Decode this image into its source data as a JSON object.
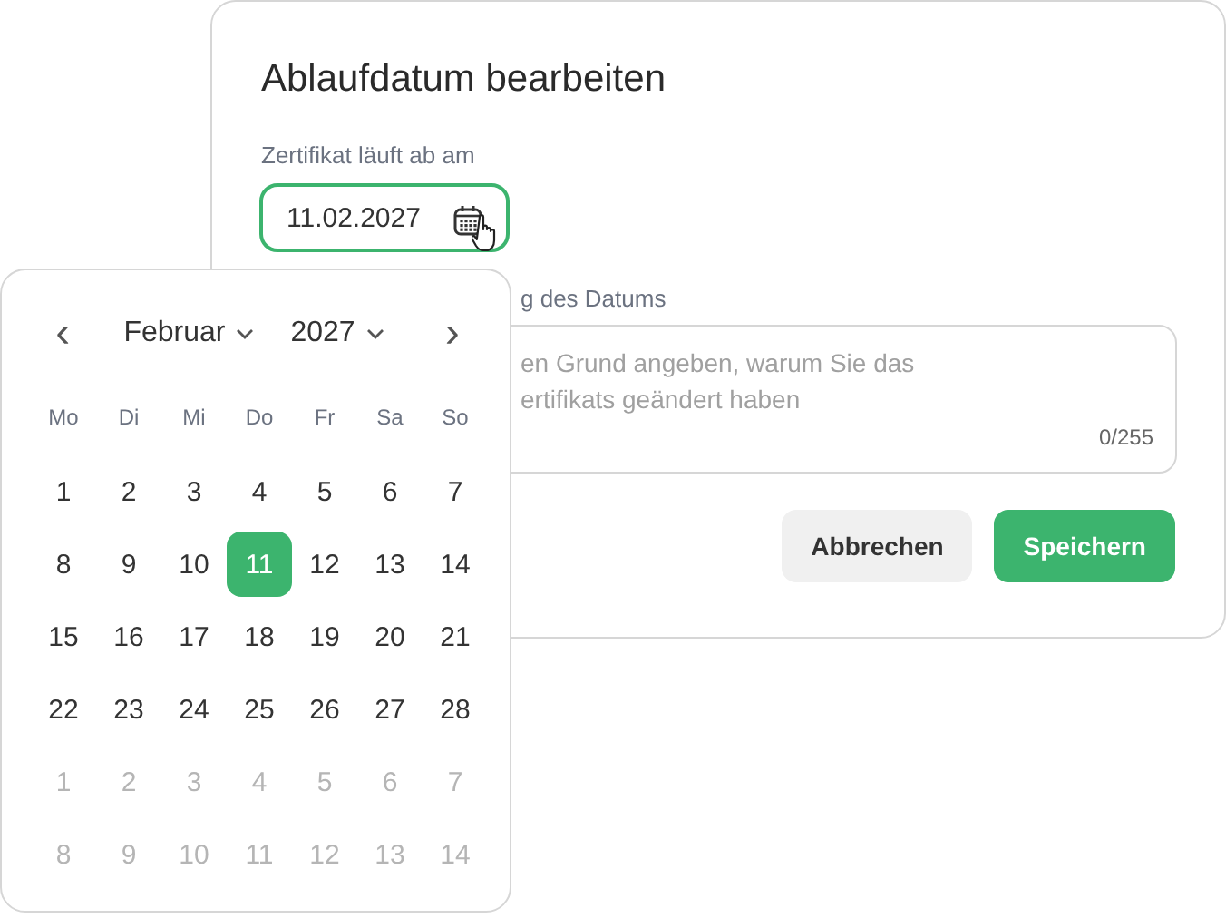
{
  "dialog": {
    "title": "Ablaufdatum bearbeiten",
    "date_label": "Zertifikat läuft ab am",
    "date_value": "11.02.2027",
    "focused": true,
    "reason_label": "g des Datums",
    "reason_placeholder": [
      "en Grund angeben, warum Sie das",
      "ertifikats geändert haben"
    ],
    "counter": "0/255",
    "buttons": [
      {
        "label": "Abbrechen",
        "kind": "secondary"
      },
      {
        "label": "Speichern",
        "kind": "primary"
      }
    ]
  },
  "calendar": {
    "prev": "‹",
    "next": "›",
    "month": "Februar",
    "year": "2027",
    "weekdays": [
      "Mo",
      "Di",
      "Mi",
      "Do",
      "Fr",
      "Sa",
      "So"
    ],
    "weeks": [
      [
        {
          "label": "1",
          "muted": false,
          "selected": false
        },
        {
          "label": "2",
          "muted": false,
          "selected": false
        },
        {
          "label": "3",
          "muted": false,
          "selected": false
        },
        {
          "label": "4",
          "muted": false,
          "selected": false
        },
        {
          "label": "5",
          "muted": false,
          "selected": false
        },
        {
          "label": "6",
          "muted": false,
          "selected": false
        },
        {
          "label": "7",
          "muted": false,
          "selected": false
        }
      ],
      [
        {
          "label": "8",
          "muted": false,
          "selected": false
        },
        {
          "label": "9",
          "muted": false,
          "selected": false
        },
        {
          "label": "10",
          "muted": false,
          "selected": false
        },
        {
          "label": "11",
          "muted": false,
          "selected": true
        },
        {
          "label": "12",
          "muted": false,
          "selected": false
        },
        {
          "label": "13",
          "muted": false,
          "selected": false
        },
        {
          "label": "14",
          "muted": false,
          "selected": false
        }
      ],
      [
        {
          "label": "15",
          "muted": false,
          "selected": false
        },
        {
          "label": "16",
          "muted": false,
          "selected": false
        },
        {
          "label": "17",
          "muted": false,
          "selected": false
        },
        {
          "label": "18",
          "muted": false,
          "selected": false
        },
        {
          "label": "19",
          "muted": false,
          "selected": false
        },
        {
          "label": "20",
          "muted": false,
          "selected": false
        },
        {
          "label": "21",
          "muted": false,
          "selected": false
        }
      ],
      [
        {
          "label": "22",
          "muted": false,
          "selected": false
        },
        {
          "label": "23",
          "muted": false,
          "selected": false
        },
        {
          "label": "24",
          "muted": false,
          "selected": false
        },
        {
          "label": "25",
          "muted": false,
          "selected": false
        },
        {
          "label": "26",
          "muted": false,
          "selected": false
        },
        {
          "label": "27",
          "muted": false,
          "selected": false
        },
        {
          "label": "28",
          "muted": false,
          "selected": false
        }
      ],
      [
        {
          "label": "1",
          "muted": true,
          "selected": false
        },
        {
          "label": "2",
          "muted": true,
          "selected": false
        },
        {
          "label": "3",
          "muted": true,
          "selected": false
        },
        {
          "label": "4",
          "muted": true,
          "selected": false
        },
        {
          "label": "5",
          "muted": true,
          "selected": false
        },
        {
          "label": "6",
          "muted": true,
          "selected": false
        },
        {
          "label": "7",
          "muted": true,
          "selected": false
        }
      ],
      [
        {
          "label": "8",
          "muted": true,
          "selected": false
        },
        {
          "label": "9",
          "muted": true,
          "selected": false
        },
        {
          "label": "10",
          "muted": true,
          "selected": false
        },
        {
          "label": "11",
          "muted": true,
          "selected": false
        },
        {
          "label": "12",
          "muted": true,
          "selected": false
        },
        {
          "label": "13",
          "muted": true,
          "selected": false
        },
        {
          "label": "14",
          "muted": true,
          "selected": false
        }
      ]
    ]
  }
}
